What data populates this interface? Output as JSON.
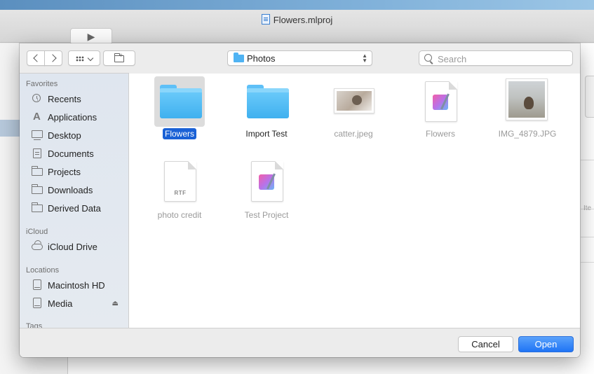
{
  "window": {
    "title": "Flowers.mlproj"
  },
  "toolbar": {
    "location": "Photos",
    "search_placeholder": "Search"
  },
  "sidebar": {
    "sections": {
      "favorites": "Favorites",
      "icloud": "iCloud",
      "locations": "Locations",
      "tags": "Tags"
    },
    "favorites": [
      {
        "label": "Recents",
        "icon": "clock-icon"
      },
      {
        "label": "Applications",
        "icon": "applications-icon"
      },
      {
        "label": "Desktop",
        "icon": "desktop-icon"
      },
      {
        "label": "Documents",
        "icon": "document-icon"
      },
      {
        "label": "Projects",
        "icon": "folder-icon"
      },
      {
        "label": "Downloads",
        "icon": "folder-icon"
      },
      {
        "label": "Derived Data",
        "icon": "folder-icon"
      }
    ],
    "icloud": [
      {
        "label": "iCloud Drive",
        "icon": "cloud-icon"
      }
    ],
    "locations": [
      {
        "label": "Macintosh HD",
        "icon": "disk-icon"
      },
      {
        "label": "Media",
        "icon": "disk-icon"
      }
    ]
  },
  "files": [
    {
      "name": "Flowers",
      "kind": "folder",
      "selected": true
    },
    {
      "name": "Import Test",
      "kind": "folder"
    },
    {
      "name": "catter.jpeg",
      "kind": "image",
      "dimmed": true
    },
    {
      "name": "Flowers",
      "kind": "project",
      "dimmed": true
    },
    {
      "name": "IMG_4879.JPG",
      "kind": "image",
      "dimmed": true
    },
    {
      "name": "photo credit",
      "kind": "rtf",
      "dimmed": true,
      "badge": "RTF"
    },
    {
      "name": "Test Project",
      "kind": "project",
      "dimmed": true
    }
  ],
  "footer": {
    "cancel_label": "Cancel",
    "open_label": "Open"
  },
  "background": {
    "right_text": "Ite"
  },
  "colors": {
    "accent": "#1f74f5",
    "selection": "#1a61d6",
    "folder": "#4fb3f3"
  }
}
